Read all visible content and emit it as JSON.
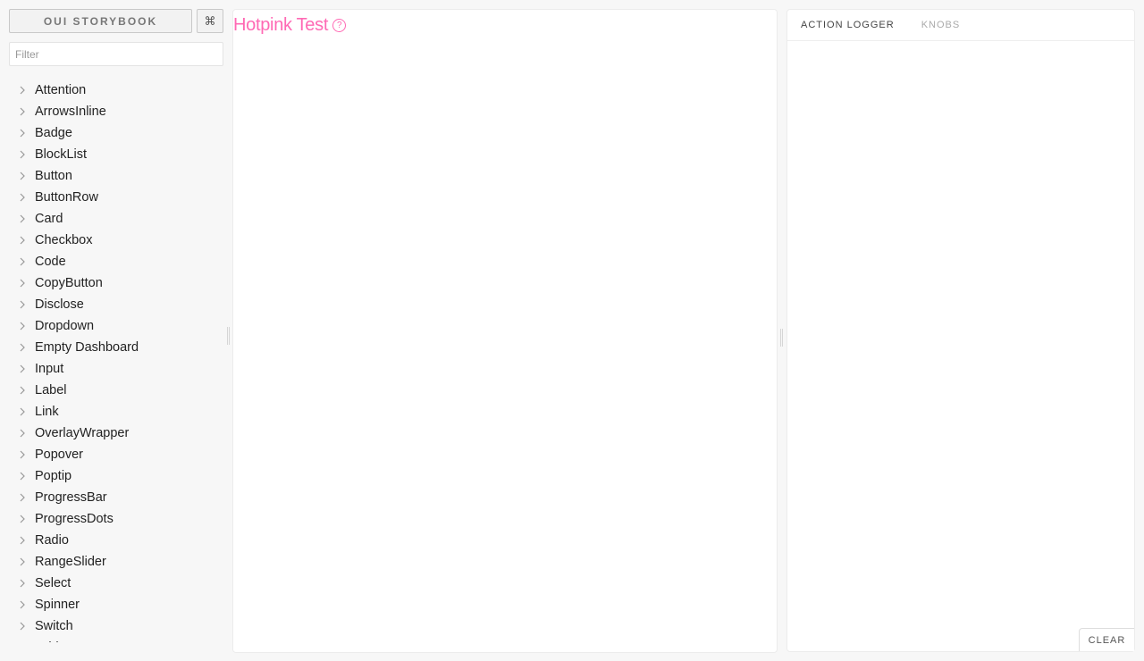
{
  "sidebar": {
    "brand_label": "OUI STORYBOOK",
    "shortcut_label": "⌘",
    "filter": {
      "placeholder": "Filter",
      "value": ""
    },
    "items": [
      {
        "label": "Attention"
      },
      {
        "label": "ArrowsInline"
      },
      {
        "label": "Badge"
      },
      {
        "label": "BlockList"
      },
      {
        "label": "Button"
      },
      {
        "label": "ButtonRow"
      },
      {
        "label": "Card"
      },
      {
        "label": "Checkbox"
      },
      {
        "label": "Code"
      },
      {
        "label": "CopyButton"
      },
      {
        "label": "Disclose"
      },
      {
        "label": "Dropdown"
      },
      {
        "label": "Empty Dashboard"
      },
      {
        "label": "Input"
      },
      {
        "label": "Label"
      },
      {
        "label": "Link"
      },
      {
        "label": "OverlayWrapper"
      },
      {
        "label": "Popover"
      },
      {
        "label": "Poptip"
      },
      {
        "label": "ProgressBar"
      },
      {
        "label": "ProgressDots"
      },
      {
        "label": "Radio"
      },
      {
        "label": "RangeSlider"
      },
      {
        "label": "Select"
      },
      {
        "label": "Spinner"
      },
      {
        "label": "Switch"
      },
      {
        "label": "Table"
      }
    ]
  },
  "preview": {
    "title": "Hotpink Test",
    "help_glyph": "?",
    "title_color": "#ff69b4"
  },
  "addons": {
    "tabs": [
      {
        "label": "ACTION LOGGER",
        "active": true
      },
      {
        "label": "KNOBS",
        "active": false
      }
    ],
    "clear_label": "CLEAR"
  }
}
